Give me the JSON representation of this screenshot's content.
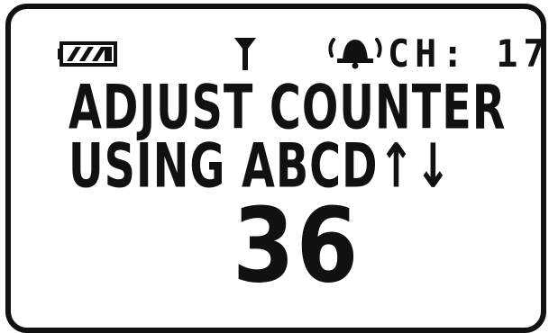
{
  "status": {
    "battery_icon": "battery-full-icon",
    "signal_icon": "antenna-icon",
    "alert_icon": "bell-ringing-icon",
    "channel_text": "CH: 17"
  },
  "message": {
    "line1": "ADJUST COUNTER",
    "line2": "USING ABCD↑↓"
  },
  "counter": {
    "value": "36"
  },
  "colors": {
    "ink": "#111111",
    "background": "#ffffff"
  }
}
